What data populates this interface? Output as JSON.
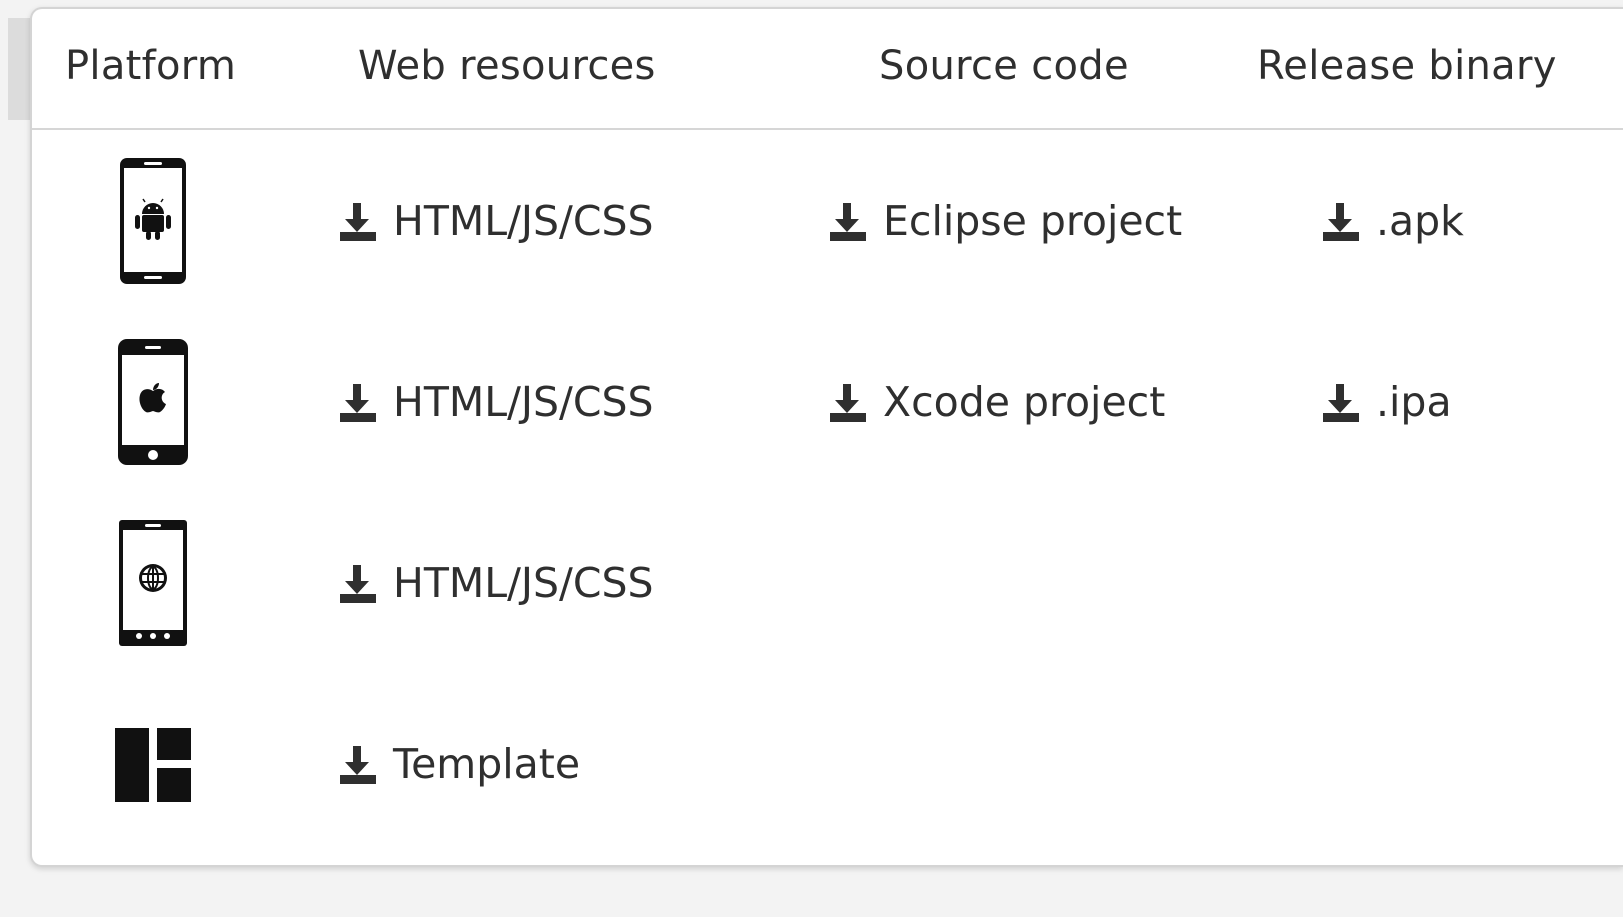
{
  "table": {
    "headers": {
      "platform": "Platform",
      "web_resources": "Web resources",
      "source_code": "Source code",
      "release_binary": "Release binary"
    },
    "rows": [
      {
        "platform_icon": "android-phone-icon",
        "web_resources": "HTML/JS/CSS",
        "source_code": "Eclipse project",
        "release_binary": ".apk"
      },
      {
        "platform_icon": "iphone-apple-icon",
        "web_resources": "HTML/JS/CSS",
        "source_code": "Xcode project",
        "release_binary": ".ipa"
      },
      {
        "platform_icon": "windows-phone-globe-icon",
        "web_resources": "HTML/JS/CSS",
        "source_code": "",
        "release_binary": ""
      },
      {
        "platform_icon": "template-layout-icon",
        "web_resources": "Template",
        "source_code": "",
        "release_binary": ""
      }
    ]
  },
  "icons": {
    "download": "download-icon"
  },
  "colors": {
    "text": "#2f2f2f",
    "border": "#d6d6d6",
    "icon": "#111111"
  }
}
